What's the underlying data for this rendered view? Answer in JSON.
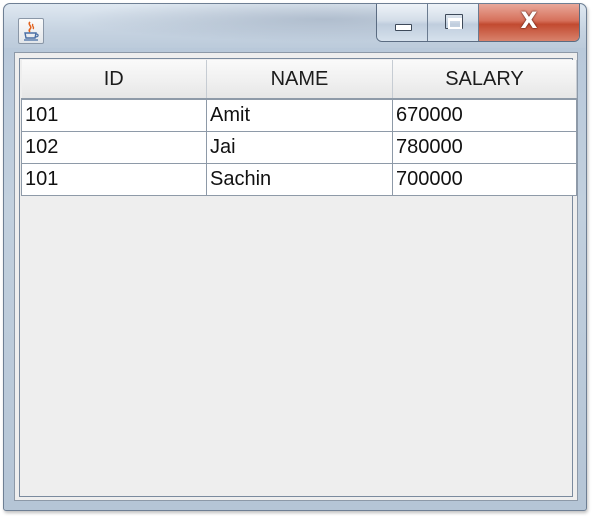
{
  "window": {
    "title": "",
    "icon": "java-coffee-cup-icon",
    "buttons": [
      "minimize-icon",
      "maximize-icon",
      "close-icon"
    ],
    "close_glyph": "X"
  },
  "table": {
    "columns": [
      "ID",
      "NAME",
      "SALARY"
    ],
    "rows": [
      [
        "101",
        "Amit",
        "670000"
      ],
      [
        "102",
        "Jai",
        "780000"
      ],
      [
        "101",
        "Sachin",
        "700000"
      ]
    ]
  },
  "colors": {
    "close_button": "#c94a30",
    "frame": "#c2d0de",
    "client_bg": "#eeeeee"
  }
}
